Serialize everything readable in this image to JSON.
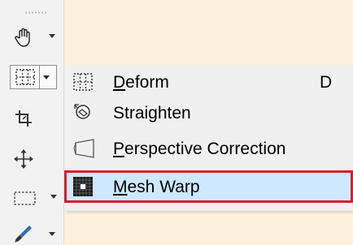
{
  "toolbar": {
    "tools": [
      {
        "icon": "pan-hand-icon",
        "has_dropdown": true
      },
      {
        "icon": "deform-grid-icon",
        "has_dropdown": true,
        "active": true
      },
      {
        "icon": "crop-icon",
        "has_dropdown": false
      },
      {
        "icon": "move-icon",
        "has_dropdown": false
      },
      {
        "icon": "rectangle-select-icon",
        "has_dropdown": true
      },
      {
        "icon": "brush-icon",
        "has_dropdown": true
      }
    ]
  },
  "menu": {
    "items": [
      {
        "pre": "",
        "accel": "D",
        "post": "eform",
        "shortcut": "D",
        "icon": "deform-grid-icon"
      },
      {
        "pre": "Straighten",
        "accel": "",
        "post": "",
        "shortcut": "",
        "icon": "straighten-rotate-icon"
      },
      {
        "pre": "",
        "accel": "P",
        "post": "erspective Correction",
        "shortcut": "",
        "icon": "perspective-icon"
      },
      {
        "pre": "",
        "accel": "M",
        "post": "esh Warp",
        "shortcut": "",
        "icon": "mesh-warp-icon",
        "selected": true
      }
    ]
  },
  "colors": {
    "canvas": "#fcf1dd",
    "menu_bg": "#f0f0f0",
    "highlight": "#cde8ff",
    "highlight_border": "#d1222c"
  }
}
